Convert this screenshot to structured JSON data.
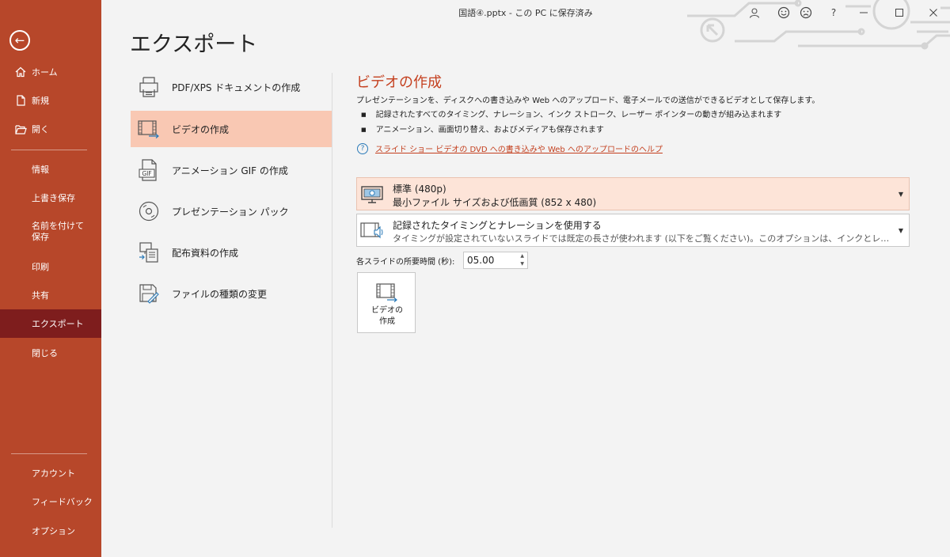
{
  "window": {
    "title": "国語④.pptx - この PC に保存済み"
  },
  "sidebar": {
    "back_icon": "back-arrow-icon",
    "top_items": [
      {
        "label": "ホーム",
        "icon": "home-icon"
      },
      {
        "label": "新規",
        "icon": "new-file-icon"
      },
      {
        "label": "開く",
        "icon": "open-folder-icon"
      }
    ],
    "mid_items": [
      {
        "label": "情報"
      },
      {
        "label": "上書き保存"
      },
      {
        "label": "名前を付けて保存"
      },
      {
        "label": "印刷"
      },
      {
        "label": "共有"
      },
      {
        "label": "エクスポート"
      },
      {
        "label": "閉じる"
      }
    ],
    "bottom_items": [
      {
        "label": "アカウント"
      },
      {
        "label": "フィードバック"
      },
      {
        "label": "オプション"
      }
    ],
    "active": "エクスポート",
    "colors": {
      "background": "#b7472a",
      "active": "#7e1d1d"
    }
  },
  "titlebar": {
    "help_label": "?",
    "icons": [
      "avatar-icon",
      "smiley-icon",
      "frown-icon",
      "help-icon",
      "minimize-icon",
      "maximize-icon",
      "close-icon"
    ]
  },
  "page": {
    "title": "エクスポート"
  },
  "export_options": [
    {
      "label": "PDF/XPS ドキュメントの作成",
      "icon": "pdf-document-icon"
    },
    {
      "label": "ビデオの作成",
      "icon": "video-film-icon"
    },
    {
      "label": "アニメーション GIF の作成",
      "icon": "gif-file-icon"
    },
    {
      "label": "プレゼンテーション パック",
      "icon": "cd-package-icon"
    },
    {
      "label": "配布資料の作成",
      "icon": "handouts-icon"
    },
    {
      "label": "ファイルの種類の変更",
      "icon": "change-file-type-icon"
    }
  ],
  "active_option": "ビデオの作成",
  "video": {
    "title": "ビデオの作成",
    "description": "プレゼンテーションを、ディスクへの書き込みや Web へのアップロード、電子メールでの送信ができるビデオとして保存します。",
    "bullets": [
      "記録されたすべてのタイミング、ナレーション、インク ストローク、レーザー ポインターの動きが組み込まれます",
      "アニメーション、画面切り替え、およびメディアも保存されます"
    ],
    "help_link": "スライド ショー ビデオの DVD への書き込みや Web へのアップロードのヘルプ",
    "quality": {
      "line1": "標準 (480p)",
      "line2": "最小ファイル サイズおよび低画質 (852 x 480)"
    },
    "timing": {
      "line1": "記録されたタイミングとナレーションを使用する",
      "line2": "タイミングが設定されていないスライドでは既定の長さが使われます (以下をご覧ください)。このオプションは、インクとレーザー ポインターの..."
    },
    "duration_label": "各スライドの所要時間 (秒):",
    "duration_value": "05.00",
    "create_button": "ビデオの\n作成"
  },
  "colors": {
    "accent": "#c4401f",
    "selected_option": "#f9c8b3",
    "selected_dropdown": "#fde4d8",
    "link_icon": "#2a7ab8"
  }
}
